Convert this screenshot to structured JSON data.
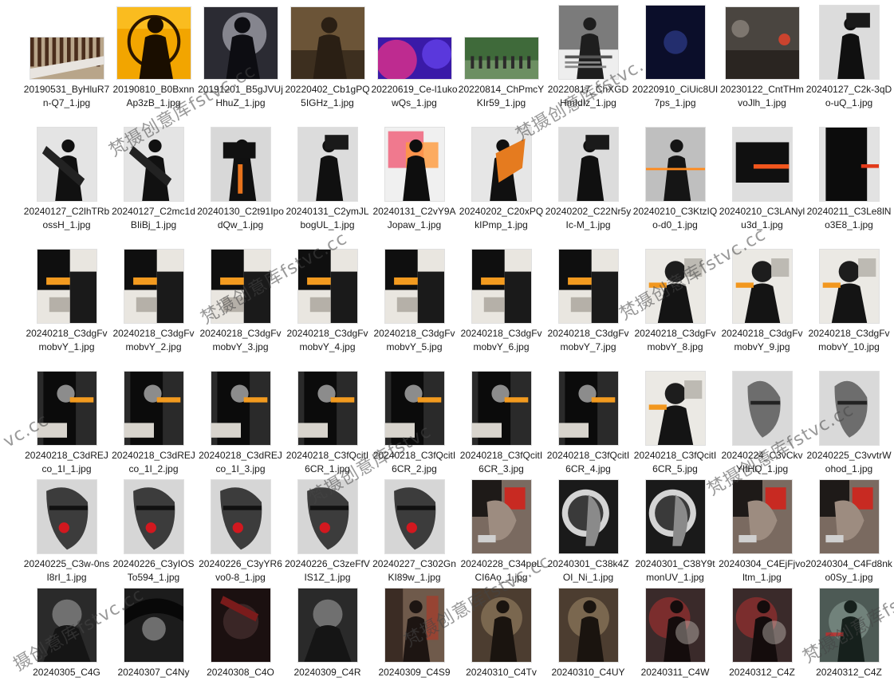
{
  "files": [
    {
      "name": "20190531_ByHluR7n-Q7_1.jpg",
      "thumb": {
        "shape": "wide",
        "style": "stripes"
      }
    },
    {
      "name": "20190810_B0BxnnAp3zB_1.jpg",
      "thumb": {
        "shape": "square",
        "style": "yellow"
      }
    },
    {
      "name": "20191201_B5gJVUjHhuZ_1.jpg",
      "thumb": {
        "shape": "square",
        "style": "night"
      }
    },
    {
      "name": "20220402_Cb1gPQ5IGHz_1.jpg",
      "thumb": {
        "shape": "square",
        "style": "brownish"
      }
    },
    {
      "name": "20220619_Ce-l1ukowQs_1.jpg",
      "thumb": {
        "shape": "wide",
        "style": "purple"
      }
    },
    {
      "name": "20220814_ChPmcYKIr59_1.jpg",
      "thumb": {
        "shape": "wide",
        "style": "park"
      }
    },
    {
      "name": "20220817_ChXGDHmIdIz_1.jpg",
      "thumb": {
        "shape": "portrait",
        "style": "grayposter"
      }
    },
    {
      "name": "20220910_CiUic8UI7ps_1.jpg",
      "thumb": {
        "shape": "portrait",
        "style": "darkblue"
      }
    },
    {
      "name": "20230122_CntTHmvoJlh_1.jpg",
      "thumb": {
        "shape": "square",
        "style": "street"
      }
    },
    {
      "name": "20240127_C2k-3qDo-uQ_1.jpg",
      "thumb": {
        "shape": "portrait",
        "style": "bwfigure"
      }
    },
    {
      "name": "20240127_C2lhTRbossH_1.jpg",
      "thumb": {
        "shape": "portrait",
        "style": "bwcross"
      }
    },
    {
      "name": "20240127_C2mc1dBIiBj_1.jpg",
      "thumb": {
        "shape": "portrait",
        "style": "bwcross"
      }
    },
    {
      "name": "20240130_C2t91IpodQw_1.jpg",
      "thumb": {
        "shape": "portrait",
        "style": "bwred"
      }
    },
    {
      "name": "20240131_C2ymJLbogUL_1.jpg",
      "thumb": {
        "shape": "portrait",
        "style": "bwfigure"
      }
    },
    {
      "name": "20240131_C2vY9AJopaw_1.jpg",
      "thumb": {
        "shape": "portrait",
        "style": "pinkblk"
      }
    },
    {
      "name": "20240202_C20xPQkIPmp_1.jpg",
      "thumb": {
        "shape": "portrait",
        "style": "orangeblk"
      }
    },
    {
      "name": "20240202_C22Nr5yIc-M_1.jpg",
      "thumb": {
        "shape": "portrait",
        "style": "bwfigure"
      }
    },
    {
      "name": "20240210_C3KtzIQo-d0_1.jpg",
      "thumb": {
        "shape": "portrait",
        "style": "graysilh"
      }
    },
    {
      "name": "20240210_C3LANylu3d_1.jpg",
      "thumb": {
        "shape": "portrait",
        "style": "blkorange"
      }
    },
    {
      "name": "20240211_C3Le8lNo3E8_1.jpg",
      "thumb": {
        "shape": "portrait",
        "style": "blkred"
      }
    },
    {
      "name": "20240218_C3dgFvmobvY_1.jpg",
      "thumb": {
        "shape": "portrait",
        "style": "collage"
      }
    },
    {
      "name": "20240218_C3dgFvmobvY_2.jpg",
      "thumb": {
        "shape": "portrait",
        "style": "collage"
      }
    },
    {
      "name": "20240218_C3dgFvmobvY_3.jpg",
      "thumb": {
        "shape": "portrait",
        "style": "collage"
      }
    },
    {
      "name": "20240218_C3dgFvmobvY_4.jpg",
      "thumb": {
        "shape": "portrait",
        "style": "collage"
      }
    },
    {
      "name": "20240218_C3dgFvmobvY_5.jpg",
      "thumb": {
        "shape": "portrait",
        "style": "collage"
      }
    },
    {
      "name": "20240218_C3dgFvmobvY_6.jpg",
      "thumb": {
        "shape": "portrait",
        "style": "collage"
      }
    },
    {
      "name": "20240218_C3dgFvmobvY_7.jpg",
      "thumb": {
        "shape": "portrait",
        "style": "collage"
      }
    },
    {
      "name": "20240218_C3dgFvmobvY_8.jpg",
      "thumb": {
        "shape": "portrait",
        "style": "collagelight"
      }
    },
    {
      "name": "20240218_C3dgFvmobvY_9.jpg",
      "thumb": {
        "shape": "portrait",
        "style": "collagelight"
      }
    },
    {
      "name": "20240218_C3dgFvmobvY_10.jpg",
      "thumb": {
        "shape": "portrait",
        "style": "collagelight"
      }
    },
    {
      "name": "20240218_C3dREJco_1I_1.jpg",
      "thumb": {
        "shape": "portrait",
        "style": "collagedark"
      }
    },
    {
      "name": "20240218_C3dREJco_1I_2.jpg",
      "thumb": {
        "shape": "portrait",
        "style": "collagedark"
      }
    },
    {
      "name": "20240218_C3dREJco_1I_3.jpg",
      "thumb": {
        "shape": "portrait",
        "style": "collagedark"
      }
    },
    {
      "name": "20240218_C3fQcitI6CR_1.jpg",
      "thumb": {
        "shape": "portrait",
        "style": "collagedark"
      }
    },
    {
      "name": "20240218_C3fQcitI6CR_2.jpg",
      "thumb": {
        "shape": "portrait",
        "style": "collagedark"
      }
    },
    {
      "name": "20240218_C3fQcitI6CR_3.jpg",
      "thumb": {
        "shape": "portrait",
        "style": "collagedark"
      }
    },
    {
      "name": "20240218_C3fQcitI6CR_4.jpg",
      "thumb": {
        "shape": "portrait",
        "style": "collagedark"
      }
    },
    {
      "name": "20240218_C3fQcitI6CR_5.jpg",
      "thumb": {
        "shape": "portrait",
        "style": "collagelight"
      }
    },
    {
      "name": "20240224_C3vCkvYIIHQ_1.jpg",
      "thumb": {
        "shape": "portrait",
        "style": "face"
      }
    },
    {
      "name": "20240225_C3vvtrWohod_1.jpg",
      "thumb": {
        "shape": "portrait",
        "style": "face"
      }
    },
    {
      "name": "20240225_C3w-0nsI8rI_1.jpg",
      "thumb": {
        "shape": "portrait",
        "style": "facered"
      }
    },
    {
      "name": "20240226_C3yIOSTo594_1.jpg",
      "thumb": {
        "shape": "portrait",
        "style": "facered"
      }
    },
    {
      "name": "20240226_C3yYR6vo0-8_1.jpg",
      "thumb": {
        "shape": "portrait",
        "style": "facered"
      }
    },
    {
      "name": "20240226_C3zeFfVIS1Z_1.jpg",
      "thumb": {
        "shape": "portrait",
        "style": "facered"
      }
    },
    {
      "name": "20240227_C302GnKI89w_1.jpg",
      "thumb": {
        "shape": "portrait",
        "style": "facered"
      }
    },
    {
      "name": "20240228_C34poLCI6Ao_1.jpg",
      "thumb": {
        "shape": "portrait",
        "style": "redcollage"
      }
    },
    {
      "name": "20240301_C38k4ZOI_Ni_1.jpg",
      "thumb": {
        "shape": "portrait",
        "style": "circleface"
      }
    },
    {
      "name": "20240301_C38Y9tmonUV_1.jpg",
      "thumb": {
        "shape": "portrait",
        "style": "circleface"
      }
    },
    {
      "name": "20240304_C4EjFjvoltm_1.jpg",
      "thumb": {
        "shape": "portrait",
        "style": "redcollage"
      }
    },
    {
      "name": "20240304_C4Fd8nko0Sy_1.jpg",
      "thumb": {
        "shape": "portrait",
        "style": "redcollage"
      }
    },
    {
      "name": "20240305_C4G",
      "thumb": {
        "shape": "portrait",
        "style": "darkgray"
      }
    },
    {
      "name": "20240307_C4Ny",
      "thumb": {
        "shape": "portrait",
        "style": "blackfeather"
      }
    },
    {
      "name": "20240308_C4O",
      "thumb": {
        "shape": "portrait",
        "style": "darkred"
      }
    },
    {
      "name": "20240309_C4R",
      "thumb": {
        "shape": "portrait",
        "style": "darkgray"
      }
    },
    {
      "name": "20240309_C4S9",
      "thumb": {
        "shape": "portrait",
        "style": "sepiared"
      }
    },
    {
      "name": "20240310_C4Tv",
      "thumb": {
        "shape": "portrait",
        "style": "sepiablur"
      }
    },
    {
      "name": "20240310_C4UY",
      "thumb": {
        "shape": "portrait",
        "style": "sepiablur"
      }
    },
    {
      "name": "20240311_C4W",
      "thumb": {
        "shape": "portrait",
        "style": "redblur"
      }
    },
    {
      "name": "20240312_C4Z",
      "thumb": {
        "shape": "portrait",
        "style": "redblur"
      }
    },
    {
      "name": "20240312_C4Z",
      "thumb": {
        "shape": "portrait",
        "style": "greenblur"
      }
    }
  ],
  "watermarks": [
    "梵摄创意库fstvc.cc",
    "梵摄创意库fstvc.",
    "梵摄创意库fstvc.cc",
    "梵摄创意库fstvc.cc",
    "vc.cc",
    "梵摄创意库fstvc",
    "梵摄创意库fstvc.cc",
    "梵摄创意库fstvc.cc",
    "摄创意库fstvc.cc",
    "梵摄创意库fstvc."
  ],
  "colors": {
    "label_text": "#1a1a1a",
    "background": "#ffffff",
    "watermark": "#464646"
  }
}
